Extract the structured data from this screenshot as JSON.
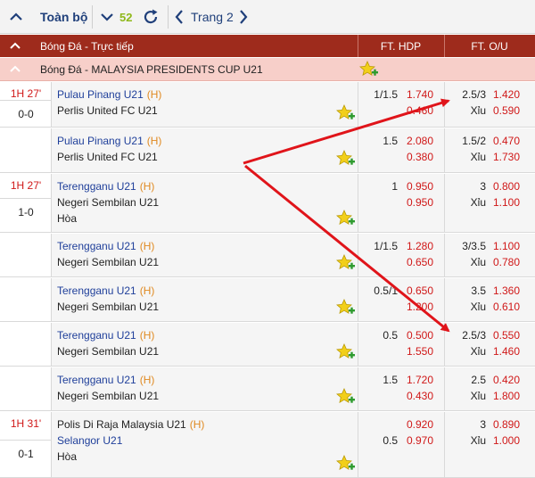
{
  "toolbar": {
    "label": "Toàn bộ",
    "count": "52",
    "page": "Trang 2"
  },
  "section": {
    "title": "Bóng Đá - Trực tiếp",
    "col_hdp": "FT. HDP",
    "col_ou": "FT. O/U"
  },
  "league": {
    "name": "Bóng Đá - MALAYSIA PRESIDENTS CUP U21"
  },
  "matches": [
    {
      "time": "1H 27'",
      "score": "0-0",
      "home": "Pulau Pinang U21",
      "home_mark": "(H)",
      "away": "Perlis United FC U21",
      "hdp_line": "1/1.5",
      "hdp_home": "1.740",
      "hdp_away": "0.460",
      "ou_line": "2.5/3",
      "ou_over": "1.420",
      "ou_under_label": "Xỉu",
      "ou_under": "0.590"
    },
    {
      "home": "Pulau Pinang U21",
      "home_mark": "(H)",
      "away": "Perlis United FC U21",
      "hdp_line": "1.5",
      "hdp_home": "2.080",
      "hdp_away": "0.380",
      "ou_line": "1.5/2",
      "ou_over": "0.470",
      "ou_under_label": "Xỉu",
      "ou_under": "1.730"
    },
    {
      "time": "1H 27'",
      "score": "1-0",
      "home": "Terengganu U21",
      "home_mark": "(H)",
      "away": "Negeri Sembilan U21",
      "draw": "Hòa",
      "hdp_line": "1",
      "hdp_home": "0.950",
      "hdp_away": "0.950",
      "ou_line": "3",
      "ou_over": "0.800",
      "ou_under_label": "Xỉu",
      "ou_under": "1.100"
    },
    {
      "home": "Terengganu U21",
      "home_mark": "(H)",
      "away": "Negeri Sembilan U21",
      "hdp_line": "1/1.5",
      "hdp_home": "1.280",
      "hdp_away": "0.650",
      "ou_line": "3/3.5",
      "ou_over": "1.100",
      "ou_under_label": "Xỉu",
      "ou_under": "0.780"
    },
    {
      "home": "Terengganu U21",
      "home_mark": "(H)",
      "away": "Negeri Sembilan U21",
      "hdp_line": "0.5/1",
      "hdp_home": "0.650",
      "hdp_away": "1.200",
      "ou_line": "3.5",
      "ou_over": "1.360",
      "ou_under_label": "Xỉu",
      "ou_under": "0.610"
    },
    {
      "home": "Terengganu U21",
      "home_mark": "(H)",
      "away": "Negeri Sembilan U21",
      "hdp_line": "0.5",
      "hdp_home": "0.500",
      "hdp_away": "1.550",
      "ou_line": "2.5/3",
      "ou_over": "0.550",
      "ou_under_label": "Xỉu",
      "ou_under": "1.460"
    },
    {
      "home": "Terengganu U21",
      "home_mark": "(H)",
      "away": "Negeri Sembilan U21",
      "hdp_line": "1.5",
      "hdp_home": "1.720",
      "hdp_away": "0.430",
      "ou_line": "2.5",
      "ou_over": "0.420",
      "ou_under_label": "Xỉu",
      "ou_under": "1.800"
    },
    {
      "time": "1H 31'",
      "score": "0-1",
      "home": "Polis Di Raja Malaysia U21",
      "home_mark": "(H)",
      "away": "Selangor U21",
      "draw": "Hòa",
      "hdp_line": "0.5",
      "hdp_home": "0.920",
      "hdp_away": "0.970",
      "ou_line": "3",
      "ou_over": "0.890",
      "ou_under_label": "Xỉu",
      "ou_under": "1.000"
    }
  ],
  "colors": {
    "section_bg": "#9e2b1c",
    "league_bg": "#f7cfc9",
    "odds_red": "#d01818",
    "team_blue": "#1f3f9a",
    "annotation_arrow": "#e0141a"
  }
}
